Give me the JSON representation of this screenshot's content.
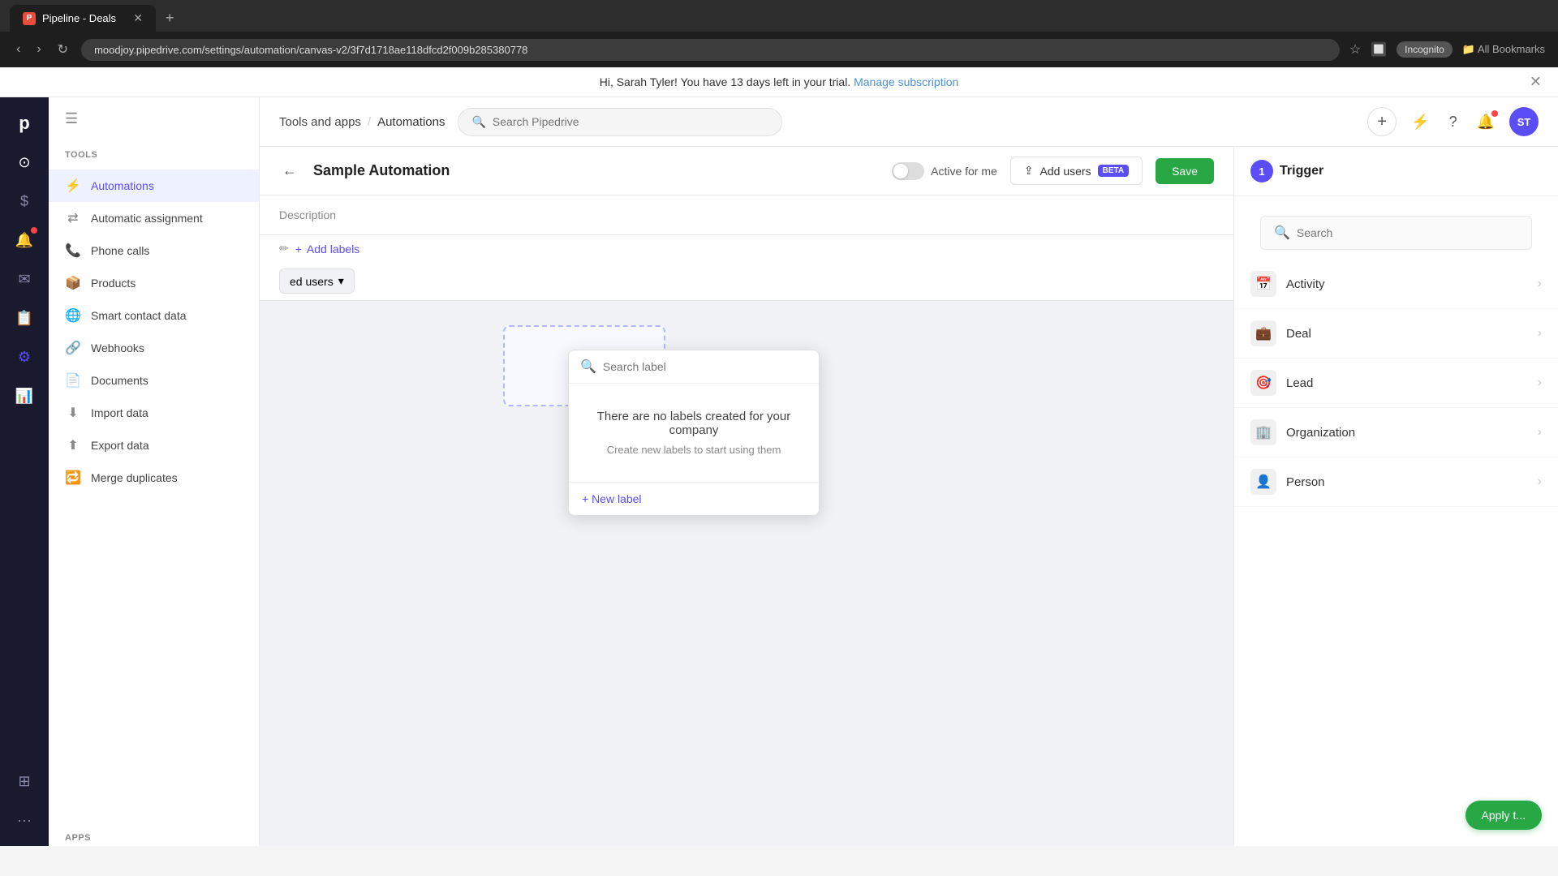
{
  "browser": {
    "url": "moodjoy.pipedrive.com/settings/automation/canvas-v2/3f7d1718ae118dfcd2f009b285380778",
    "tab_title": "Pipeline - Deals",
    "tab_favicon": "P",
    "new_tab_label": "+",
    "incognito_label": "Incognito",
    "bookmarks_label": "All Bookmarks"
  },
  "notification": {
    "text": "Hi, Sarah Tyler! You have 13 days left in your trial.",
    "link_text": "Manage subscription"
  },
  "topbar": {
    "breadcrumb_parent": "Tools and apps",
    "breadcrumb_separator": "/",
    "breadcrumb_current": "Automations",
    "search_placeholder": "Search Pipedrive",
    "add_icon": "+",
    "avatar_initials": "ST"
  },
  "sidebar": {
    "section_title": "TOOLS",
    "items": [
      {
        "label": "Automations",
        "icon": "⚡",
        "active": true
      },
      {
        "label": "Automatic assignment",
        "icon": "🔀"
      },
      {
        "label": "Phone calls",
        "icon": "📞"
      },
      {
        "label": "Products",
        "icon": "📦"
      },
      {
        "label": "Smart contact data",
        "icon": "🌐"
      },
      {
        "label": "Webhooks",
        "icon": "🔗"
      },
      {
        "label": "Documents",
        "icon": "📄"
      },
      {
        "label": "Import data",
        "icon": "⬇"
      },
      {
        "label": "Export data",
        "icon": "⬆"
      },
      {
        "label": "Merge duplicates",
        "icon": "🔁"
      }
    ],
    "apps_section": "APPS",
    "more_label": "···"
  },
  "canvas_header": {
    "title": "Sample Automation",
    "description_label": "Description",
    "toggle_label": "Active for me",
    "add_users_label": "Add users",
    "beta_label": "BETA",
    "save_label": "Save"
  },
  "add_labels": {
    "button_label": "+ Add labels"
  },
  "label_dropdown": {
    "search_placeholder": "Search label",
    "empty_title": "There are no labels created for your company",
    "empty_subtitle": "Create new labels to start using them",
    "new_label": "+ New label"
  },
  "users_dropdown": {
    "label": "ed users",
    "chevron": "▾"
  },
  "right_panel": {
    "trigger_number": "1",
    "trigger_title": "Trigger",
    "search_placeholder": "Search",
    "items": [
      {
        "label": "Activity",
        "icon": "📅"
      },
      {
        "label": "Deal",
        "icon": "💼"
      },
      {
        "label": "Lead",
        "icon": "🎯"
      },
      {
        "label": "Organization",
        "icon": "🏢"
      },
      {
        "label": "Person",
        "icon": "👤"
      }
    ],
    "apply_button": "Apply t..."
  }
}
